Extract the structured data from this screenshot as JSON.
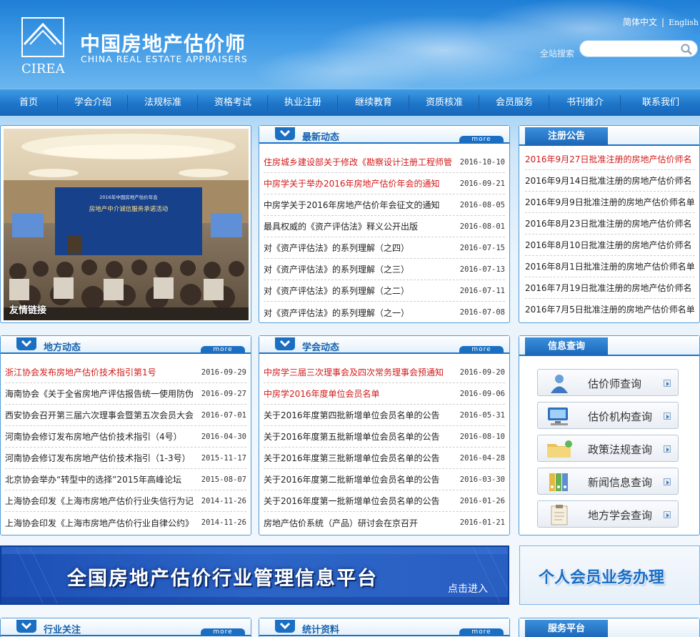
{
  "header": {
    "logo_abbr": "CIREA",
    "title_cn": "中国房地产估价师",
    "title_en": "CHINA REAL ESTATE APPRAISERS",
    "lang_cn": "简体中文",
    "lang_sep": "|",
    "lang_en": "English",
    "search_label": "全站搜索",
    "search_placeholder": ""
  },
  "nav": {
    "items": [
      "首页",
      "学会介绍",
      "法规标准",
      "资格考试",
      "执业注册",
      "继续教育",
      "资质核准",
      "会员服务",
      "书刊推介",
      "联系我们"
    ]
  },
  "photo": {
    "caption": "友情链接",
    "screen_title": "2016年中国房地产估价年会",
    "screen_subtitle": "房地产中介诚信服务承诺活动"
  },
  "latest_news": {
    "title": "最新动态",
    "more": "more",
    "items": [
      {
        "title": "住房城乡建设部关于修改《勘察设计注册工程师管",
        "date": "2016-10-10",
        "hot": true
      },
      {
        "title": "中房学关于举办2016年房地产估价年会的通知",
        "date": "2016-09-21",
        "hot": true
      },
      {
        "title": "中房学关于2016年房地产估价年会征文的通知",
        "date": "2016-08-05",
        "hot": false
      },
      {
        "title": "最具权威的《资产评估法》释义公开出版",
        "date": "2016-08-01",
        "hot": false
      },
      {
        "title": "对《资产评估法》的系列理解（之四）",
        "date": "2016-07-15",
        "hot": false
      },
      {
        "title": "对《资产评估法》的系列理解（之三）",
        "date": "2016-07-13",
        "hot": false
      },
      {
        "title": "对《资产评估法》的系列理解（之二）",
        "date": "2016-07-11",
        "hot": false
      },
      {
        "title": "对《资产评估法》的系列理解（之一）",
        "date": "2016-07-08",
        "hot": false
      }
    ]
  },
  "registration": {
    "title": "注册公告",
    "items": [
      {
        "title": "2016年9月27日批准注册的房地产估价师名",
        "hot": true
      },
      {
        "title": "2016年9月14日批准注册的房地产估价师名",
        "hot": false
      },
      {
        "title": "2016年9月9日批准注册的房地产估价师名单",
        "hot": false
      },
      {
        "title": "2016年8月23日批准注册的房地产估价师名",
        "hot": false
      },
      {
        "title": "2016年8月10日批准注册的房地产估价师名",
        "hot": false
      },
      {
        "title": "2016年8月1日批准注册的房地产估价师名单",
        "hot": false
      },
      {
        "title": "2016年7月19日批准注册的房地产估价师名",
        "hot": false
      },
      {
        "title": "2016年7月5日批准注册的房地产估价师名单",
        "hot": false
      }
    ]
  },
  "local_news": {
    "title": "地方动态",
    "more": "more",
    "items": [
      {
        "title": "浙江协会发布房地产估价技术指引第1号",
        "date": "2016-09-29",
        "hot": true
      },
      {
        "title": "海南协会《关于全省房地产评估报告统一使用防伪",
        "date": "2016-09-27",
        "hot": false
      },
      {
        "title": "西安协会召开第三届六次理事会暨第五次会员大会",
        "date": "2016-07-01",
        "hot": false
      },
      {
        "title": "河南协会修订发布房地产估价技术指引（4号）",
        "date": "2016-04-30",
        "hot": false
      },
      {
        "title": "河南协会修订发布房地产估价技术指引（1-3号）",
        "date": "2015-11-17",
        "hot": false
      },
      {
        "title": "北京协会举办“转型中的选择”2015年高峰论坛",
        "date": "2015-08-07",
        "hot": false
      },
      {
        "title": "上海协会印发《上海市房地产估价行业失信行为记",
        "date": "2014-11-26",
        "hot": false
      },
      {
        "title": "上海协会印发《上海市房地产估价行业自律公约》",
        "date": "2014-11-26",
        "hot": false
      }
    ]
  },
  "society_news": {
    "title": "学会动态",
    "more": "more",
    "items": [
      {
        "title": "中房学三届三次理事会及四次常务理事会预通知",
        "date": "2016-09-20",
        "hot": true
      },
      {
        "title": "中房学2016年度单位会员名单",
        "date": "2016-09-06",
        "hot": true
      },
      {
        "title": "关于2016年度第四批新增单位会员名单的公告",
        "date": "2016-05-31",
        "hot": false
      },
      {
        "title": "关于2016年度第五批新增单位会员名单的公告",
        "date": "2016-08-10",
        "hot": false
      },
      {
        "title": "关于2016年度第三批新增单位会员名单的公告",
        "date": "2016-04-28",
        "hot": false
      },
      {
        "title": "关于2016年度第二批新增单位会员名单的公告",
        "date": "2016-03-30",
        "hot": false
      },
      {
        "title": "关于2016年度第一批新增单位会员名单的公告",
        "date": "2016-01-26",
        "hot": false
      },
      {
        "title": "房地产估价系统（产品）研讨会在京召开",
        "date": "2016-01-21",
        "hot": false
      }
    ]
  },
  "info_query": {
    "title": "信息查询",
    "items": [
      {
        "label": "估价师查询",
        "icon": "person-icon"
      },
      {
        "label": "估价机构查询",
        "icon": "computer-icon"
      },
      {
        "label": "政策法规查询",
        "icon": "folder-icon"
      },
      {
        "label": "新闻信息查询",
        "icon": "binders-icon"
      },
      {
        "label": "地方学会查询",
        "icon": "clipboard-icon"
      }
    ]
  },
  "banners": {
    "main_title": "全国房地产估价行业管理信息平台",
    "main_action": "点击进入",
    "side_title": "个人会员业务办理"
  },
  "bottom": {
    "industry_title": "行业关注",
    "stats_title": "统计资料",
    "service_title": "服务平台",
    "more": "more"
  },
  "colors": {
    "brand_blue": "#1b6fc3",
    "hot_red": "#d21a1a"
  }
}
